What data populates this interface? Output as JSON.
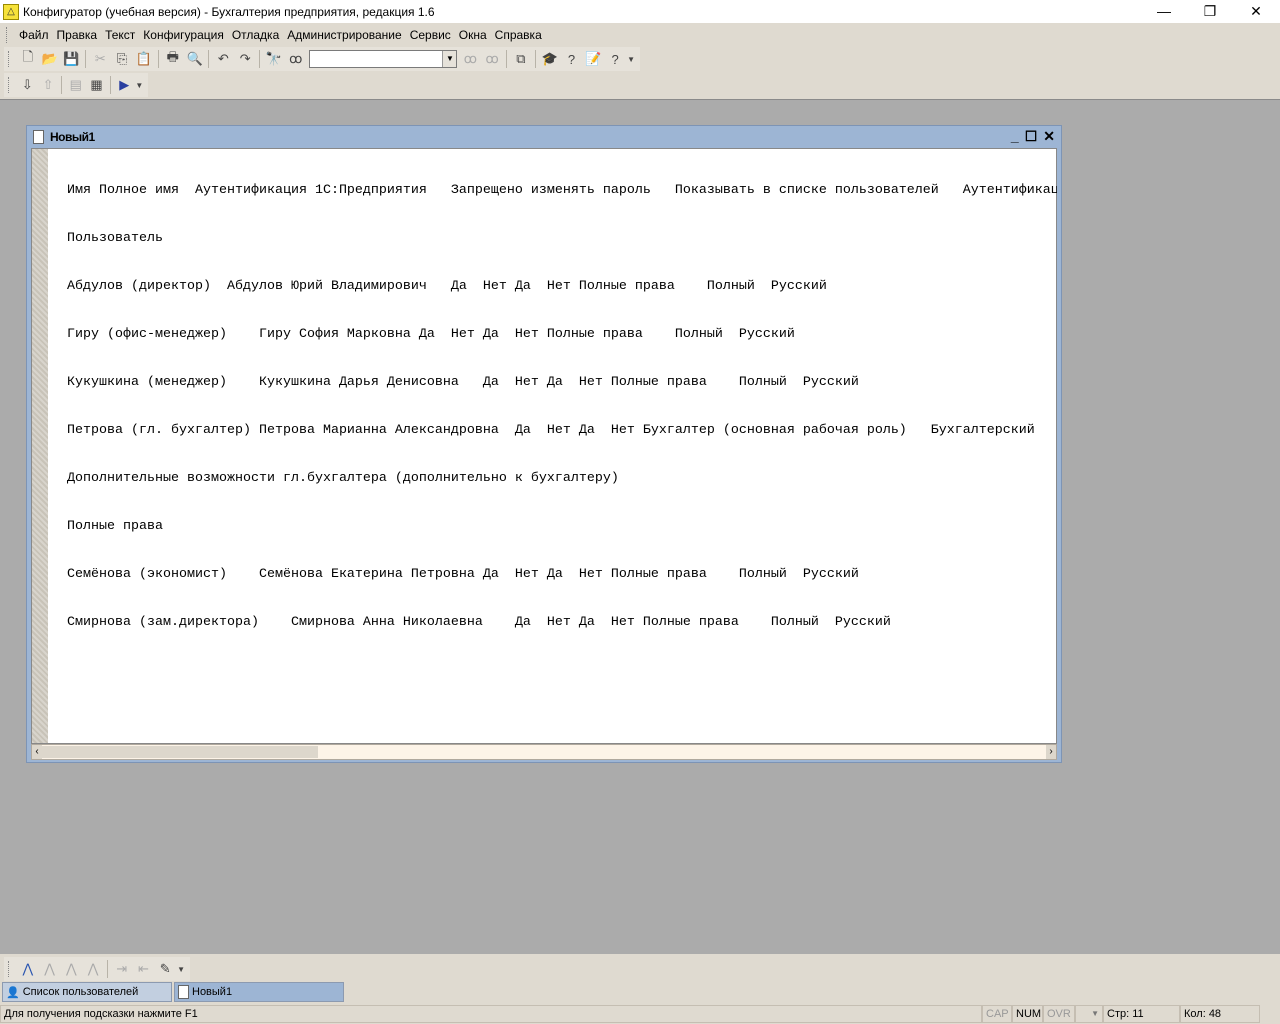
{
  "window": {
    "title": "Конфигуратор (учебная версия) - Бухгалтерия предприятия, редакция 1.6"
  },
  "menu": [
    "Файл",
    "Правка",
    "Текст",
    "Конфигурация",
    "Отладка",
    "Администрирование",
    "Сервис",
    "Окна",
    "Справка"
  ],
  "toolbar": {
    "search_value": ""
  },
  "document": {
    "title": "Новый1",
    "lines": [
      "Имя Полное имя  Аутентификация 1С:Предприятия   Запрещено изменять пароль   Показывать в списке пользователей   Аутентификац",
      "Пользователь",
      "Абдулов (директор)  Абдулов Юрий Владимирович   Да  Нет Да  Нет Полные права    Полный  Русский",
      "Гиру (офис-менеджер)    Гиру София Марковна Да  Нет Да  Нет Полные права    Полный  Русский",
      "Кукушкина (менеджер)    Кукушкина Дарья Денисовна   Да  Нет Да  Нет Полные права    Полный  Русский",
      "Петрова (гл. бухгалтер) Петрова Марианна Александровна  Да  Нет Да  Нет Бухгалтер (основная рабочая роль)   Бухгалтерский",
      "Дополнительные возможности гл.бухгалтера (дополнительно к бухгалтеру)",
      "Полные права",
      "Семёнова (экономист)    Семёнова Екатерина Петровна Да  Нет Да  Нет Полные права    Полный  Русский",
      "Смирнова (зам.директора)    Смирнова Анна Николаевна    Да  Нет Да  Нет Полные права    Полный  Русский"
    ]
  },
  "taskbar": [
    "Список пользователей",
    "Новый1"
  ],
  "status": {
    "hint": "Для получения подсказки нажмите F1",
    "cap": "CAP",
    "num": "NUM",
    "ovr": "OVR",
    "line": "Стр: 11",
    "col": "Кол: 48"
  }
}
